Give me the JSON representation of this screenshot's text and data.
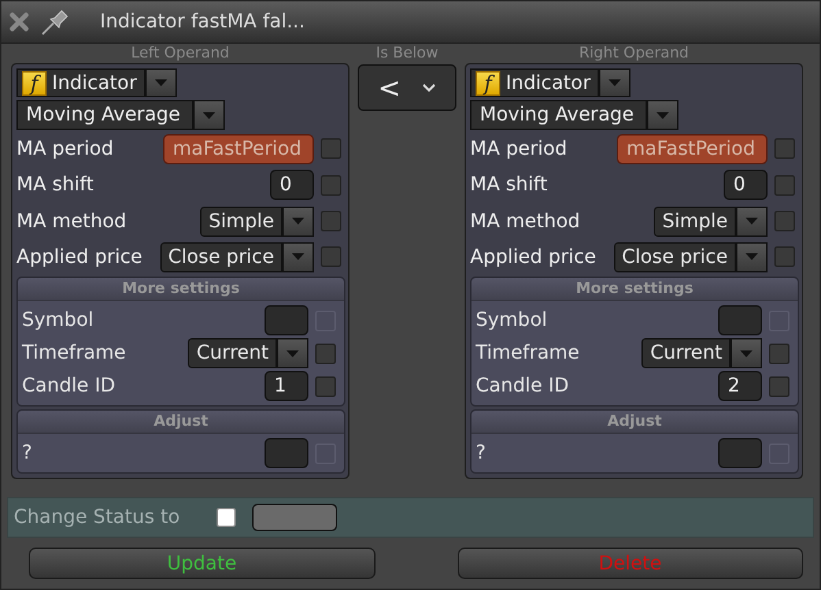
{
  "window": {
    "title": "Indicator fastMA fal..."
  },
  "operands": [
    {
      "heading": "Left Operand",
      "icon": "f",
      "type": "Indicator",
      "indicator": "Moving Average",
      "params": [
        {
          "label": "MA period",
          "kind": "variable",
          "value": "maFastPeriod",
          "checked": false,
          "disabled": false
        },
        {
          "label": "MA shift",
          "kind": "number",
          "value": "0",
          "checked": false,
          "disabled": false
        },
        {
          "label": "MA method",
          "kind": "select",
          "value": "Simple",
          "checked": false,
          "disabled": false
        },
        {
          "label": "Applied price",
          "kind": "select",
          "value": "Close price",
          "checked": false,
          "disabled": false
        }
      ],
      "sections": [
        {
          "title": "More settings",
          "params": [
            {
              "label": "Symbol",
              "kind": "empty",
              "checked": false,
              "disabled": true
            },
            {
              "label": "Timeframe",
              "kind": "select",
              "value": "Current",
              "checked": false,
              "disabled": false
            },
            {
              "label": "Candle ID",
              "kind": "number",
              "value": "1",
              "checked": false,
              "disabled": false
            }
          ]
        },
        {
          "title": "Adjust",
          "params": [
            {
              "label": "?",
              "kind": "empty",
              "checked": false,
              "disabled": true
            }
          ]
        }
      ]
    },
    {
      "heading": "Right Operand",
      "icon": "f",
      "type": "Indicator",
      "indicator": "Moving Average",
      "params": [
        {
          "label": "MA period",
          "kind": "variable",
          "value": "maFastPeriod",
          "checked": false,
          "disabled": false
        },
        {
          "label": "MA shift",
          "kind": "number",
          "value": "0",
          "checked": false,
          "disabled": false
        },
        {
          "label": "MA method",
          "kind": "select",
          "value": "Simple",
          "checked": false,
          "disabled": false
        },
        {
          "label": "Applied price",
          "kind": "select",
          "value": "Close price",
          "checked": false,
          "disabled": false
        }
      ],
      "sections": [
        {
          "title": "More settings",
          "params": [
            {
              "label": "Symbol",
              "kind": "empty",
              "checked": false,
              "disabled": true
            },
            {
              "label": "Timeframe",
              "kind": "select",
              "value": "Current",
              "checked": false,
              "disabled": false
            },
            {
              "label": "Candle ID",
              "kind": "number",
              "value": "2",
              "checked": false,
              "disabled": false
            }
          ]
        },
        {
          "title": "Adjust",
          "params": [
            {
              "label": "?",
              "kind": "empty",
              "checked": false,
              "disabled": true
            }
          ]
        }
      ]
    }
  ],
  "comparator": {
    "heading": "Is Below",
    "value": "<"
  },
  "status": {
    "label": "Change Status to",
    "checked": false
  },
  "buttons": [
    {
      "label": "Update",
      "kind": "update"
    },
    {
      "label": "Delete",
      "kind": "delete"
    }
  ]
}
